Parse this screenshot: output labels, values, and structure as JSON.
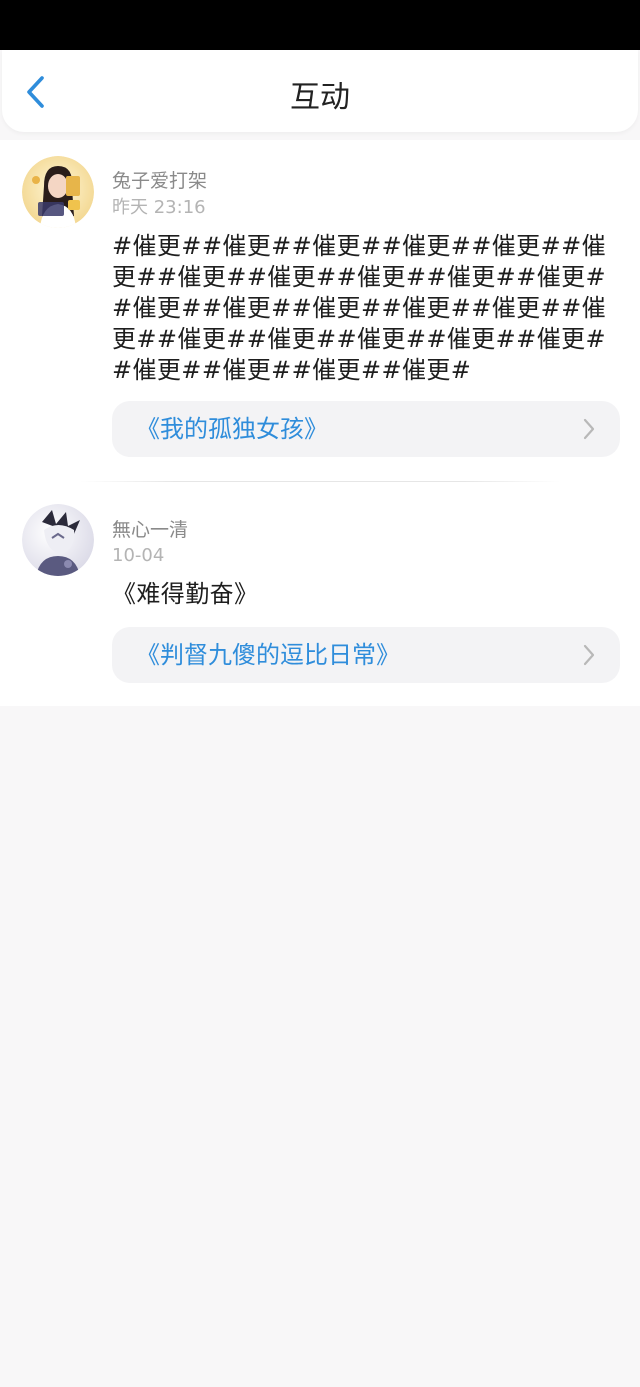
{
  "header": {
    "title": "互动",
    "back_icon": "chevron-left-icon",
    "accent_color": "#2f8ddb"
  },
  "posts": [
    {
      "username": "兔子爱打架",
      "timestamp": "昨天 23:16",
      "content": "#催更##催更##催更##催更##催更##催更##催更##催更##催更##催更##催更##催更##催更##催更##催更##催更##催更##催更##催更##催更##催更##催更##催更##催更##催更##催更#",
      "book": "《我的孤独女孩》"
    },
    {
      "username": "無心一清",
      "timestamp": "10-04",
      "content": "《难得勤奋》",
      "book": "《判督九傻的逗比日常》"
    }
  ]
}
